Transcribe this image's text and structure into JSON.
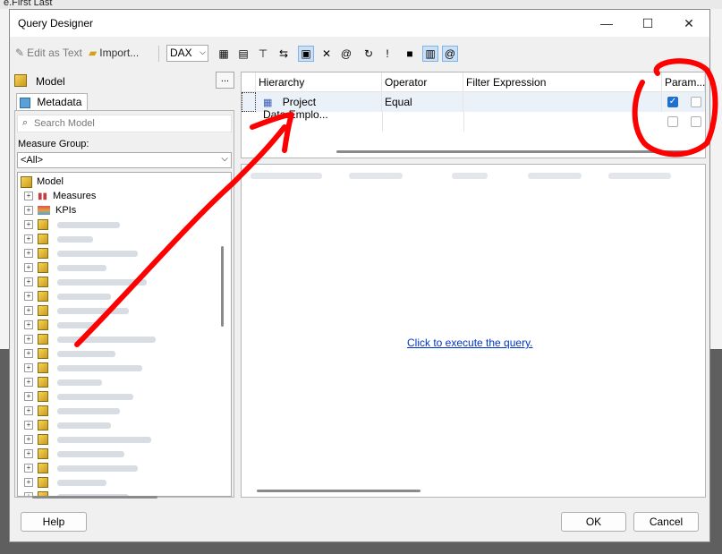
{
  "background": {
    "behind_text": "e.First Last"
  },
  "window": {
    "title": "Query Designer",
    "minimize": "—",
    "maximize": "☐",
    "close": "✕"
  },
  "toolbar": {
    "edit_as_text": "Edit as Text",
    "import": "Import...",
    "language": "DAX"
  },
  "left_pane": {
    "model_label": "Model",
    "browse_button": "...",
    "tab": "Metadata",
    "search_placeholder": "Search Model",
    "measure_group_label": "Measure Group:",
    "measure_group_value": "<All>",
    "tree": {
      "root": "Model",
      "items": [
        "Measures",
        "KPIs"
      ]
    }
  },
  "filter_grid": {
    "columns": [
      "Hierarchy",
      "Operator",
      "Filter Expression",
      "Param..."
    ],
    "rows": [
      {
        "hierarchy": "Project Data.Emplo...",
        "operator": "Equal",
        "filter_expression": "",
        "param_checked": true
      }
    ]
  },
  "results": {
    "execute_link": "Click to execute the query."
  },
  "buttons": {
    "help": "Help",
    "ok": "OK",
    "cancel": "Cancel"
  },
  "annotation": {
    "color": "#ff0000"
  }
}
